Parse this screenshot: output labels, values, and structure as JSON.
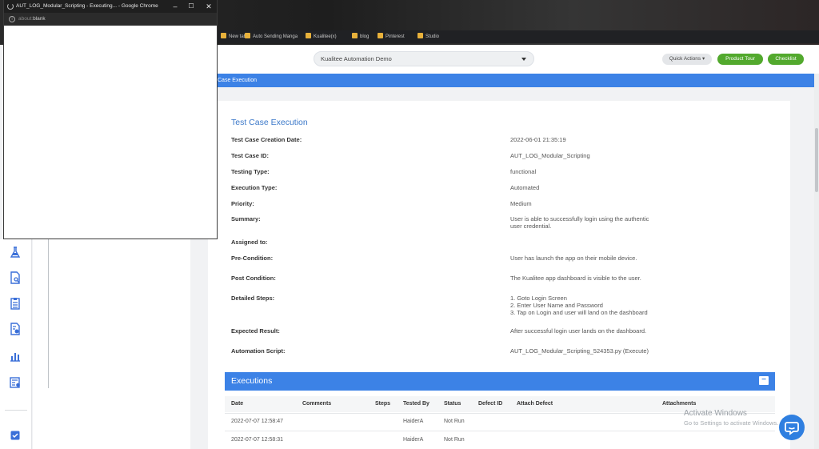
{
  "popup": {
    "title": "AUT_LOG_Modular_Scripting - Executing... - Google Chrome",
    "url_scheme": "about:",
    "url_path": "blank",
    "info_glyph": "i",
    "minimize_glyph": "–",
    "maximize_glyph": "☐",
    "close_glyph": "✕"
  },
  "header": {
    "project": "Kualitee Automation Demo",
    "quick_actions": "Quick Actions ▾",
    "product_tour": "Product Tour",
    "checklist": "Checklist"
  },
  "breadcrumb": "Case Execution",
  "test_case": {
    "section_title": "Test Case Execution",
    "fields": [
      {
        "label": "Test Case Creation Date:",
        "value": "2022-06-01 21:35:19"
      },
      {
        "label": "Test Case ID:",
        "value": "AUT_LOG_Modular_Scripting"
      },
      {
        "label": "Testing Type:",
        "value": "functional"
      },
      {
        "label": "Execution Type:",
        "value": "Automated"
      },
      {
        "label": "Priority:",
        "value": "Medium"
      },
      {
        "label": "Summary:",
        "value": "User is able to successfully login using the authentic user credential."
      },
      {
        "label": "Assigned to:",
        "value": ""
      },
      {
        "label": "Pre-Condition:",
        "value": "User has launch the app on their mobile device."
      },
      {
        "label": "Post Condition:",
        "value": "The Kualitee app dashboard is visible to the user."
      },
      {
        "label": "Detailed Steps:",
        "value": "1. Goto Login Screen\n2. Enter User Name and Password\n3. Tap on Login and user will land on the dashboard"
      },
      {
        "label": "Expected Result:",
        "value": "After successful login user lands on the dashboard."
      },
      {
        "label": "Automation Script:",
        "value": "AUT_LOG_Modular_Scripting_524353.py (Execute)"
      }
    ]
  },
  "executions": {
    "title": "Executions",
    "toggle": "−",
    "columns": [
      "Date",
      "Comments",
      "Steps",
      "Tested By",
      "Status",
      "Defect ID",
      "Attach Defect",
      "Attachments"
    ],
    "rows": [
      {
        "date": "2022-07-07 12:58:47",
        "tested_by": "HaiderA",
        "status": "Not Run"
      },
      {
        "date": "2022-07-07 12:58:31",
        "tested_by": "HaiderA",
        "status": "Not Run"
      }
    ]
  },
  "bookmarks": [
    "New tab",
    "Auto Sending Manga",
    "Kualitee(x)",
    "blog",
    "Pinterest",
    "Studio"
  ],
  "watermark": {
    "line1": "Activate Windows",
    "line2": "Go to Settings to activate Windows."
  },
  "sidebar_icons": [
    "flask-icon",
    "document-search-icon",
    "clipboard-list-icon",
    "report-settings-icon",
    "bar-chart-icon",
    "sheet-settings-icon",
    "checkbox-icon"
  ],
  "colors": {
    "primary_blue": "#3c82e6",
    "green": "#52a92d",
    "title_blue": "#3b78c9"
  }
}
